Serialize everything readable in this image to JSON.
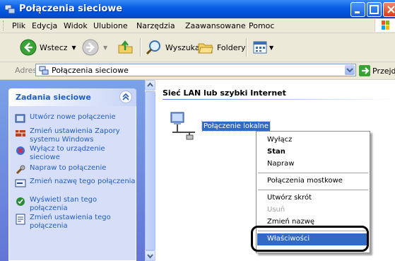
{
  "window": {
    "title": "Połączenia sieciowe"
  },
  "menu": [
    "Plik",
    "Edycja",
    "Widok",
    "Ulubione",
    "Narzędzia",
    "Zaawansowane",
    "Pomoc"
  ],
  "toolbar": {
    "back": "Wstecz",
    "search": "Wyszukaj",
    "folders": "Foldery"
  },
  "address": {
    "label": "Adres",
    "value": "Połączenia sieciowe",
    "go": "Przejdź"
  },
  "tasks": {
    "title": "Zadania sieciowe",
    "items": [
      {
        "label": "Utwórz nowe połączenie",
        "icon": "new-connection-icon"
      },
      {
        "label": "Zmień ustawienia Zapory systemu Windows",
        "icon": "firewall-icon"
      },
      {
        "label": "Wyłącz to urządzenie sieciowe",
        "icon": "disable-device-icon"
      },
      {
        "label": "Napraw to połączenie",
        "icon": "repair-icon"
      },
      {
        "label": "Zmień nazwę tego połączenia",
        "icon": "rename-icon"
      },
      {
        "label": "Wyświetl stan tego połączenia",
        "icon": "status-icon"
      },
      {
        "label": "Zmień ustawienia tego połączenia",
        "icon": "settings-icon"
      }
    ]
  },
  "content": {
    "group_title": "Sieć LAN lub szybki Internet",
    "connection_label": "Połączenie lokalne"
  },
  "context_menu": {
    "items": [
      "Wyłącz",
      "Stan",
      "Napraw",
      "Połączenia mostkowe",
      "Utwórz skrót",
      "Usuń",
      "Zmień nazwę",
      "Właściwości"
    ]
  },
  "colors": {
    "titlebar": "#0a5fe6",
    "selection": "#316ac5",
    "task_link": "#215dc6"
  }
}
